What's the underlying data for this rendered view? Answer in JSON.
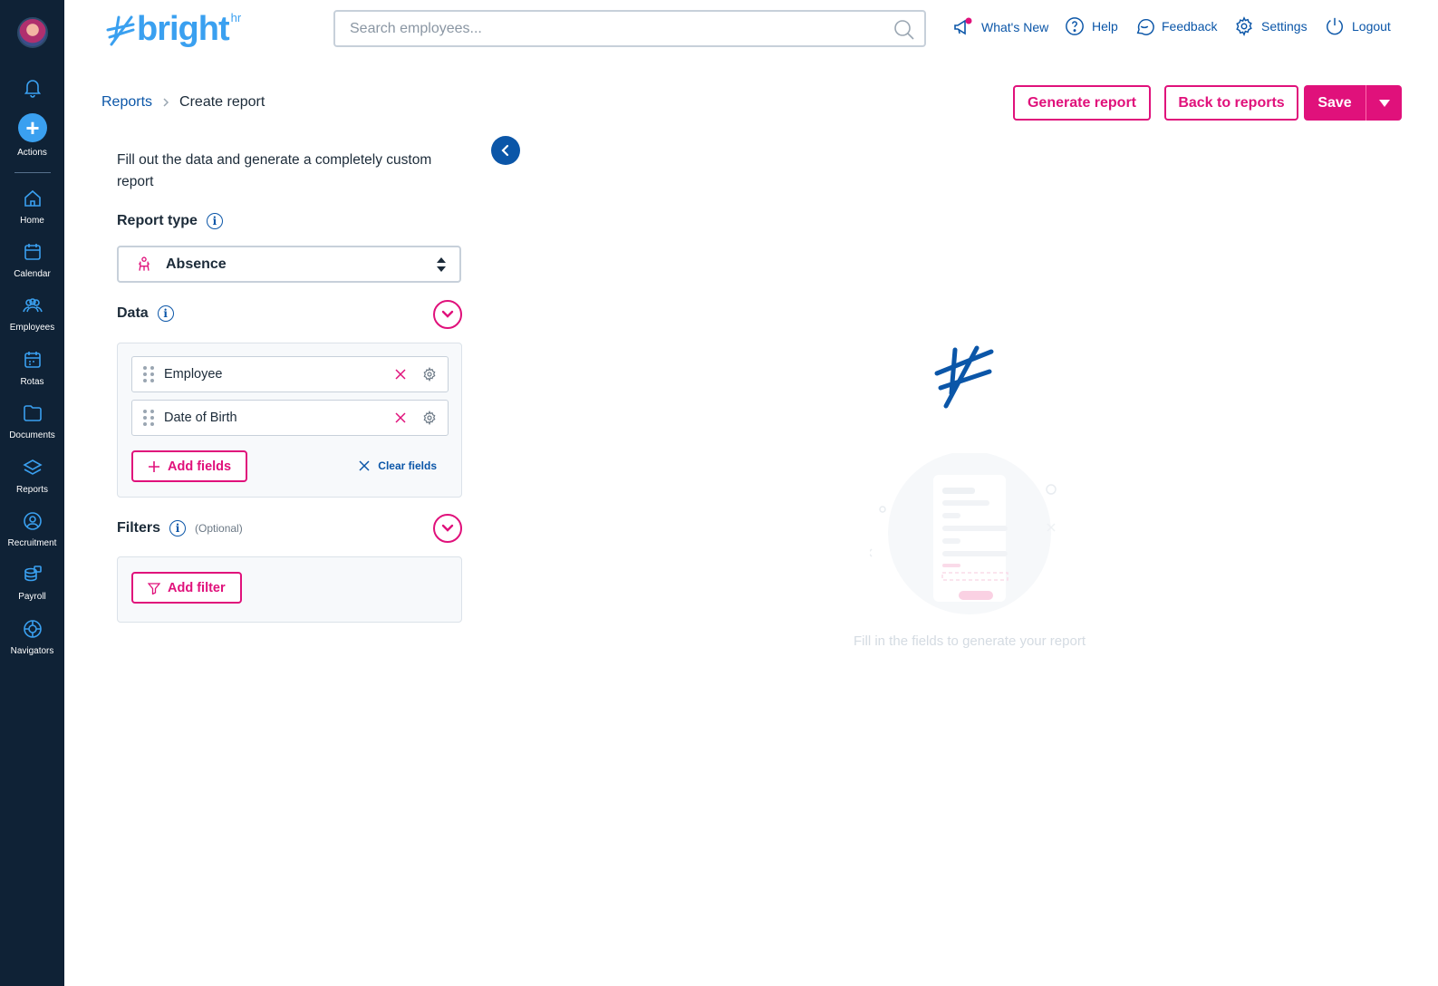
{
  "app": {
    "logo_text": "bright",
    "logo_suffix": "hr"
  },
  "sidebar": {
    "actions_label": "Actions",
    "items": [
      {
        "label": "Home",
        "icon": "home-icon"
      },
      {
        "label": "Calendar",
        "icon": "calendar-icon"
      },
      {
        "label": "Employees",
        "icon": "employees-icon"
      },
      {
        "label": "Rotas",
        "icon": "rotas-icon"
      },
      {
        "label": "Documents",
        "icon": "documents-icon"
      },
      {
        "label": "Reports",
        "icon": "reports-icon"
      },
      {
        "label": "Recruitment",
        "icon": "recruitment-icon"
      },
      {
        "label": "Payroll",
        "icon": "payroll-icon"
      },
      {
        "label": "Navigators",
        "icon": "navigators-icon"
      }
    ]
  },
  "header": {
    "search_placeholder": "Search employees...",
    "whats_new": "What's New",
    "help": "Help",
    "feedback": "Feedback",
    "settings": "Settings",
    "logout": "Logout"
  },
  "breadcrumb": {
    "parent": "Reports",
    "current": "Create report"
  },
  "actions": {
    "generate": "Generate report",
    "back": "Back to reports",
    "save": "Save"
  },
  "panel": {
    "intro": "Fill out the data and generate a completely custom report",
    "report_type_title": "Report type",
    "report_type_value": "Absence",
    "data_title": "Data",
    "fields": [
      "Employee",
      "Date of Birth"
    ],
    "add_fields": "Add fields",
    "clear_fields": "Clear fields",
    "filters_title": "Filters",
    "filters_optional": "(Optional)",
    "add_filter": "Add filter"
  },
  "empty_state": {
    "message": "Fill in the fields to generate your report"
  },
  "colors": {
    "sidebar": "#0f2236",
    "brand_pink": "#e0117b",
    "brand_blue": "#0b56a8",
    "accent": "#3aa0f0"
  }
}
